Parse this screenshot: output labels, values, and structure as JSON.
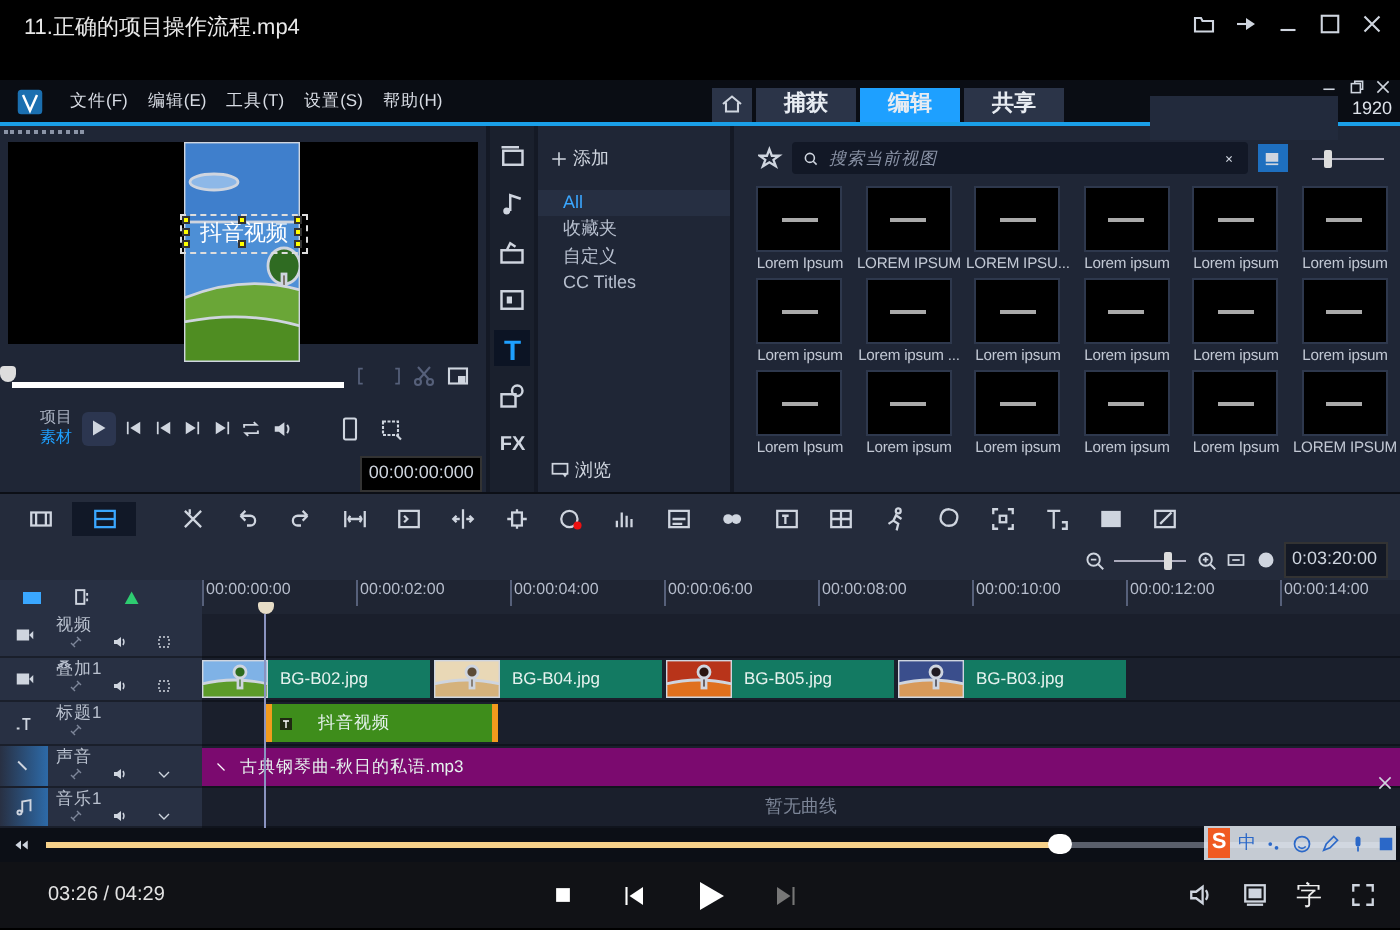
{
  "player": {
    "title": "11.正确的项目操作流程.mp4",
    "progress": {
      "level": 0.76
    },
    "time": "03:26 / 04:29",
    "subtitle_button": "字"
  },
  "editor": {
    "menu": [
      "文件(F)",
      "编辑(E)",
      "工具(T)",
      "设置(S)",
      "帮助(H)"
    ],
    "tabs": [
      {
        "label": "捕获",
        "selected": false
      },
      {
        "label": "编辑",
        "selected": true
      },
      {
        "label": "共享",
        "selected": false
      }
    ],
    "resolution": "1920",
    "preview": {
      "caption": "抖音视频",
      "scrub": {
        "level": 0
      },
      "modes": [
        {
          "label": "项目",
          "selected": false
        },
        {
          "label": "素材",
          "selected": true
        }
      ],
      "timecode": "00:00:00:000"
    },
    "library": {
      "sidebar": [
        {
          "kind": "media",
          "selected": false
        },
        {
          "kind": "audio",
          "selected": false
        },
        {
          "kind": "project",
          "selected": false
        },
        {
          "kind": "transition",
          "selected": false
        },
        {
          "kind": "title",
          "label": "T",
          "selected": true
        },
        {
          "kind": "graphics",
          "selected": false
        },
        {
          "kind": "filter",
          "label": "FX",
          "selected": false
        }
      ],
      "add_label": "添加",
      "categories": [
        {
          "label": "All",
          "selected": true
        },
        {
          "label": "收藏夹",
          "selected": false
        },
        {
          "label": "自定义",
          "selected": false
        },
        {
          "label": "CC Titles",
          "selected": false
        }
      ],
      "browse_label": "浏览",
      "search_placeholder": "搜索当前视图",
      "size_slider": {
        "level": 0.2
      },
      "thumbnails": [
        {
          "label": "Lorem Ipsum"
        },
        {
          "label": "LOREM IPSUM"
        },
        {
          "label": "LOREM IPSU..."
        },
        {
          "label": "Lorem ipsum"
        },
        {
          "label": "Lorem ipsum"
        },
        {
          "label": "Lorem ipsum"
        },
        {
          "label": "Lorem ipsum"
        },
        {
          "label": "Lorem ipsum ..."
        },
        {
          "label": "Lorem ipsum"
        },
        {
          "label": "Lorem ipsum"
        },
        {
          "label": "Lorem ipsum"
        },
        {
          "label": "Lorem ipsum"
        },
        {
          "label": "Lorem Ipsum"
        },
        {
          "label": "Lorem ipsum"
        },
        {
          "label": "Lorem ipsum"
        },
        {
          "label": "Lorem ipsum"
        },
        {
          "label": "Lorem Ipsum"
        },
        {
          "label": "LOREM IPSUM"
        }
      ]
    }
  },
  "timeline": {
    "views": [
      {
        "kind": "storyboard",
        "selected": false
      },
      {
        "kind": "timeline",
        "selected": true
      }
    ],
    "timecode": "0:03:20:00",
    "zoom": {
      "level": 0.75
    },
    "ruler": [
      "00:00:00:00",
      "00:00:02:00",
      "00:00:04:00",
      "00:00:06:00",
      "00:00:08:00",
      "00:00:10:00",
      "00:00:12:00",
      "00:00:14:00"
    ],
    "tracks": [
      {
        "kind": "video",
        "name": "视频"
      },
      {
        "kind": "overlay",
        "name": "叠加1",
        "clips": [
          {
            "label": "BG-B02.jpg"
          },
          {
            "label": "BG-B04.jpg"
          },
          {
            "label": "BG-B05.jpg"
          },
          {
            "label": "BG-B03.jpg"
          }
        ]
      },
      {
        "kind": "title",
        "name": "标题1",
        "clips": [
          {
            "kind": "title",
            "label": "抖音视频"
          }
        ]
      },
      {
        "kind": "voice",
        "name": "声音",
        "clips": [
          {
            "kind": "audio",
            "label": "古典钢琴曲-秋日的私语.mp3"
          }
        ]
      },
      {
        "kind": "music",
        "name": "音乐1"
      }
    ],
    "empty_note": "暂无曲线"
  },
  "ime": {
    "logo": "S",
    "mode": "中"
  }
}
